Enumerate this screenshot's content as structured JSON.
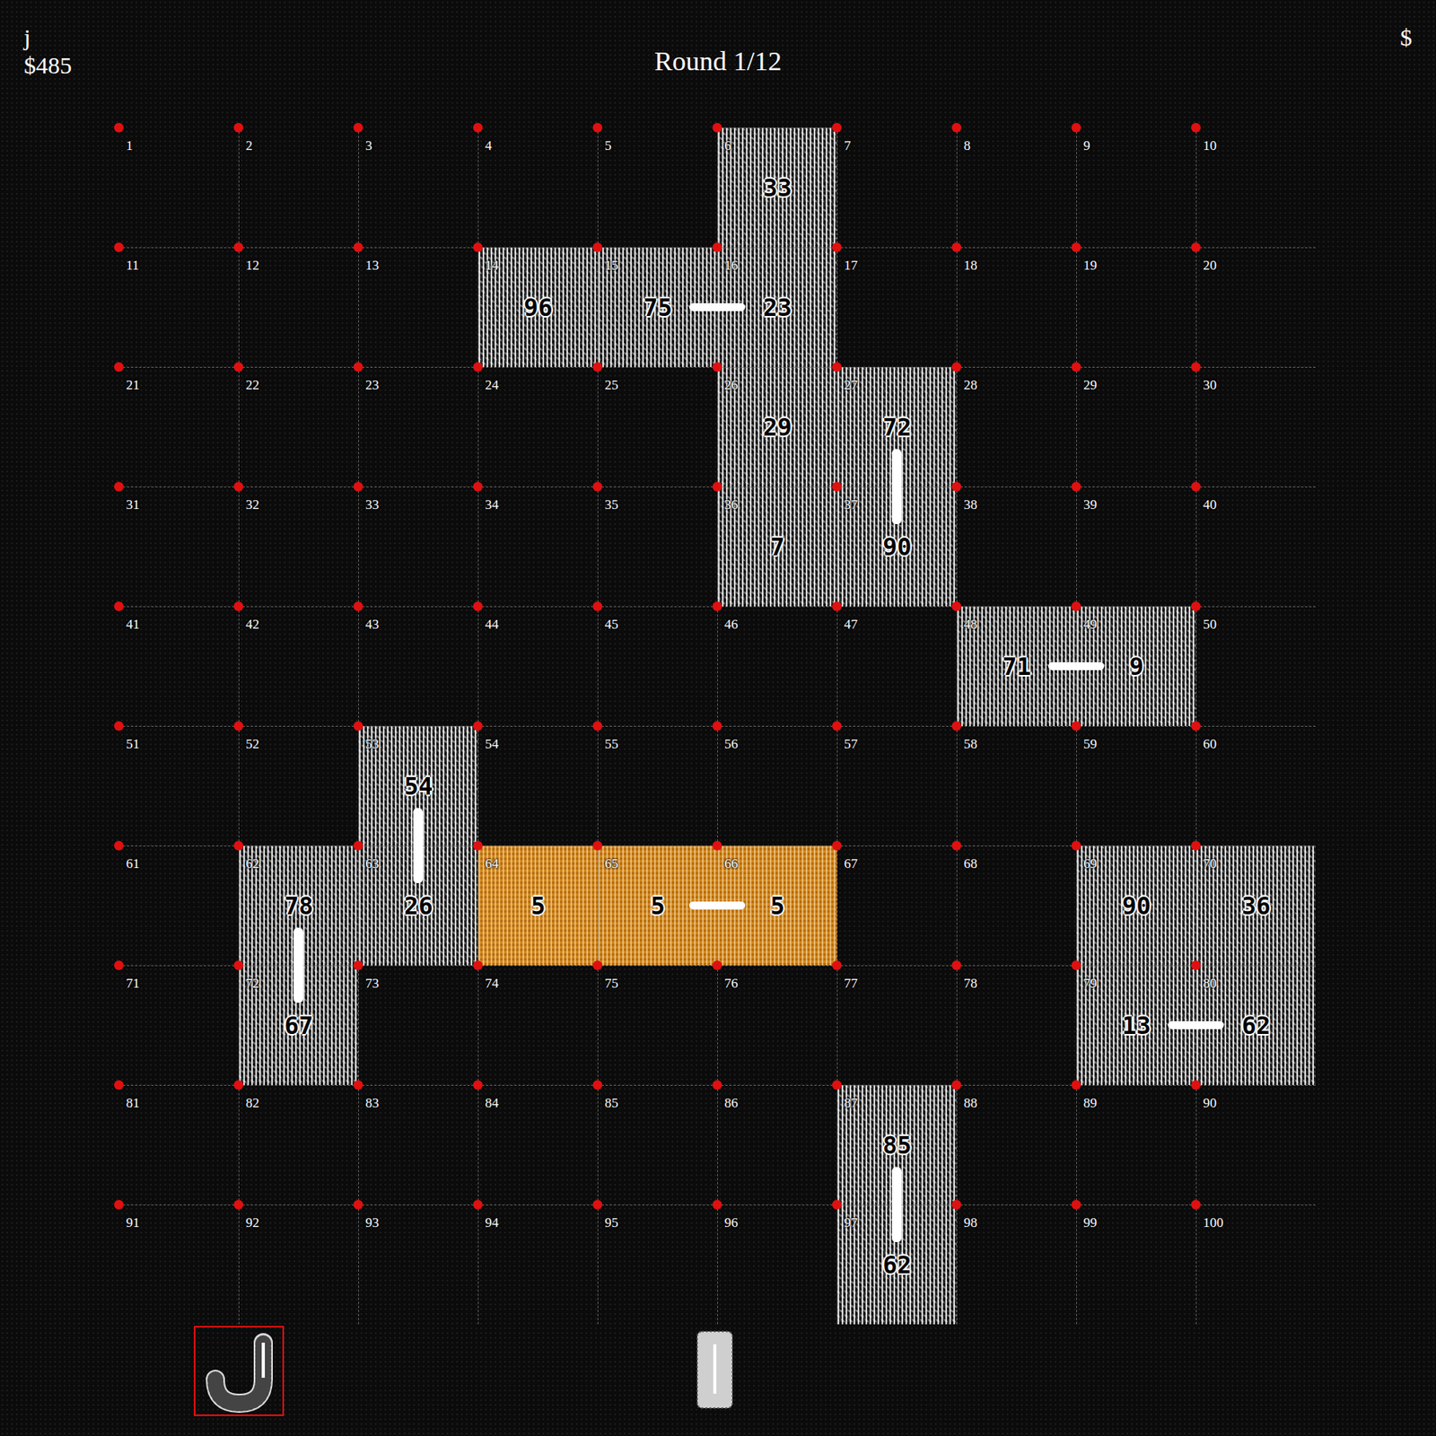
{
  "player": {
    "name": "j",
    "money": "$485"
  },
  "round": "Round 1/12",
  "opponent": {
    "money": "$"
  },
  "board": {
    "cells": [
      {
        "label": "1"
      },
      {
        "label": "2"
      },
      {
        "label": "3"
      },
      {
        "label": "4"
      },
      {
        "label": "5"
      },
      {
        "label": "6",
        "value": "33",
        "highlighted": false
      },
      {
        "label": "7"
      },
      {
        "label": "8"
      },
      {
        "label": "9"
      },
      {
        "label": "10"
      },
      {
        "label": "11"
      },
      {
        "label": "12"
      },
      {
        "label": "13"
      },
      {
        "label": "14",
        "value": "96",
        "highlighted": false
      },
      {
        "label": "15",
        "value": "75",
        "highlighted": false
      },
      {
        "label": "16",
        "value": "23",
        "highlighted": false
      },
      {
        "label": "17"
      },
      {
        "label": "18"
      },
      {
        "label": "19"
      },
      {
        "label": "20"
      },
      {
        "label": "21"
      },
      {
        "label": "22"
      },
      {
        "label": "23"
      },
      {
        "label": "24"
      },
      {
        "label": "25"
      },
      {
        "label": "26",
        "value": "29",
        "highlighted": false
      },
      {
        "label": "27",
        "value": "72",
        "highlighted": false
      },
      {
        "label": "28"
      },
      {
        "label": "29"
      },
      {
        "label": "30"
      },
      {
        "label": "31"
      },
      {
        "label": "32"
      },
      {
        "label": "33"
      },
      {
        "label": "34"
      },
      {
        "label": "35"
      },
      {
        "label": "36",
        "value": "7",
        "highlighted": false
      },
      {
        "label": "37",
        "value": "90",
        "highlighted": false
      },
      {
        "label": "38"
      },
      {
        "label": "39"
      },
      {
        "label": "40"
      },
      {
        "label": "41"
      },
      {
        "label": "42"
      },
      {
        "label": "43"
      },
      {
        "label": "44"
      },
      {
        "label": "45"
      },
      {
        "label": "46"
      },
      {
        "label": "47"
      },
      {
        "label": "48",
        "value": "71",
        "highlighted": false
      },
      {
        "label": "49",
        "value": "9",
        "highlighted": false
      },
      {
        "label": "50"
      },
      {
        "label": "51"
      },
      {
        "label": "52"
      },
      {
        "label": "53",
        "value": "54",
        "highlighted": false
      },
      {
        "label": "54"
      },
      {
        "label": "55"
      },
      {
        "label": "56"
      },
      {
        "label": "57"
      },
      {
        "label": "58"
      },
      {
        "label": "59"
      },
      {
        "label": "60"
      },
      {
        "label": "61"
      },
      {
        "label": "62",
        "value": "78",
        "highlighted": false
      },
      {
        "label": "63",
        "value": "26",
        "highlighted": false
      },
      {
        "label": "64",
        "value": "5",
        "highlighted": true
      },
      {
        "label": "65",
        "value": "5",
        "highlighted": true
      },
      {
        "label": "66",
        "value": "5",
        "highlighted": true
      },
      {
        "label": "67"
      },
      {
        "label": "68"
      },
      {
        "label": "69",
        "value": "90",
        "highlighted": false
      },
      {
        "label": "70",
        "value": "36",
        "highlighted": false
      },
      {
        "label": "71"
      },
      {
        "label": "72",
        "value": "67",
        "highlighted": false
      },
      {
        "label": "73"
      },
      {
        "label": "74"
      },
      {
        "label": "75"
      },
      {
        "label": "76"
      },
      {
        "label": "77"
      },
      {
        "label": "78"
      },
      {
        "label": "79",
        "value": "13",
        "highlighted": false
      },
      {
        "label": "80",
        "value": "62",
        "highlighted": false
      },
      {
        "label": "81"
      },
      {
        "label": "82"
      },
      {
        "label": "83"
      },
      {
        "label": "84"
      },
      {
        "label": "85"
      },
      {
        "label": "86"
      },
      {
        "label": "87",
        "value": "85",
        "highlighted": false
      },
      {
        "label": "88"
      },
      {
        "label": "89"
      },
      {
        "label": "90"
      },
      {
        "label": "91"
      },
      {
        "label": "92"
      },
      {
        "label": "93"
      },
      {
        "label": "94"
      },
      {
        "label": "95"
      },
      {
        "label": "96"
      },
      {
        "label": "97",
        "value": "62",
        "highlighted": false
      },
      {
        "label": "98"
      },
      {
        "label": "99"
      },
      {
        "label": "100"
      }
    ],
    "links": [
      {
        "from": "15",
        "to": "16"
      },
      {
        "from": "27",
        "to": "37"
      },
      {
        "from": "48",
        "to": "49"
      },
      {
        "from": "53",
        "to": "63"
      },
      {
        "from": "62",
        "to": "72"
      },
      {
        "from": "65",
        "to": "66"
      },
      {
        "from": "79",
        "to": "80"
      },
      {
        "from": "87",
        "to": "97"
      }
    ]
  },
  "tray": [
    {
      "kind": "hook",
      "selected": true
    },
    {
      "kind": "bar",
      "selected": false
    }
  ]
}
